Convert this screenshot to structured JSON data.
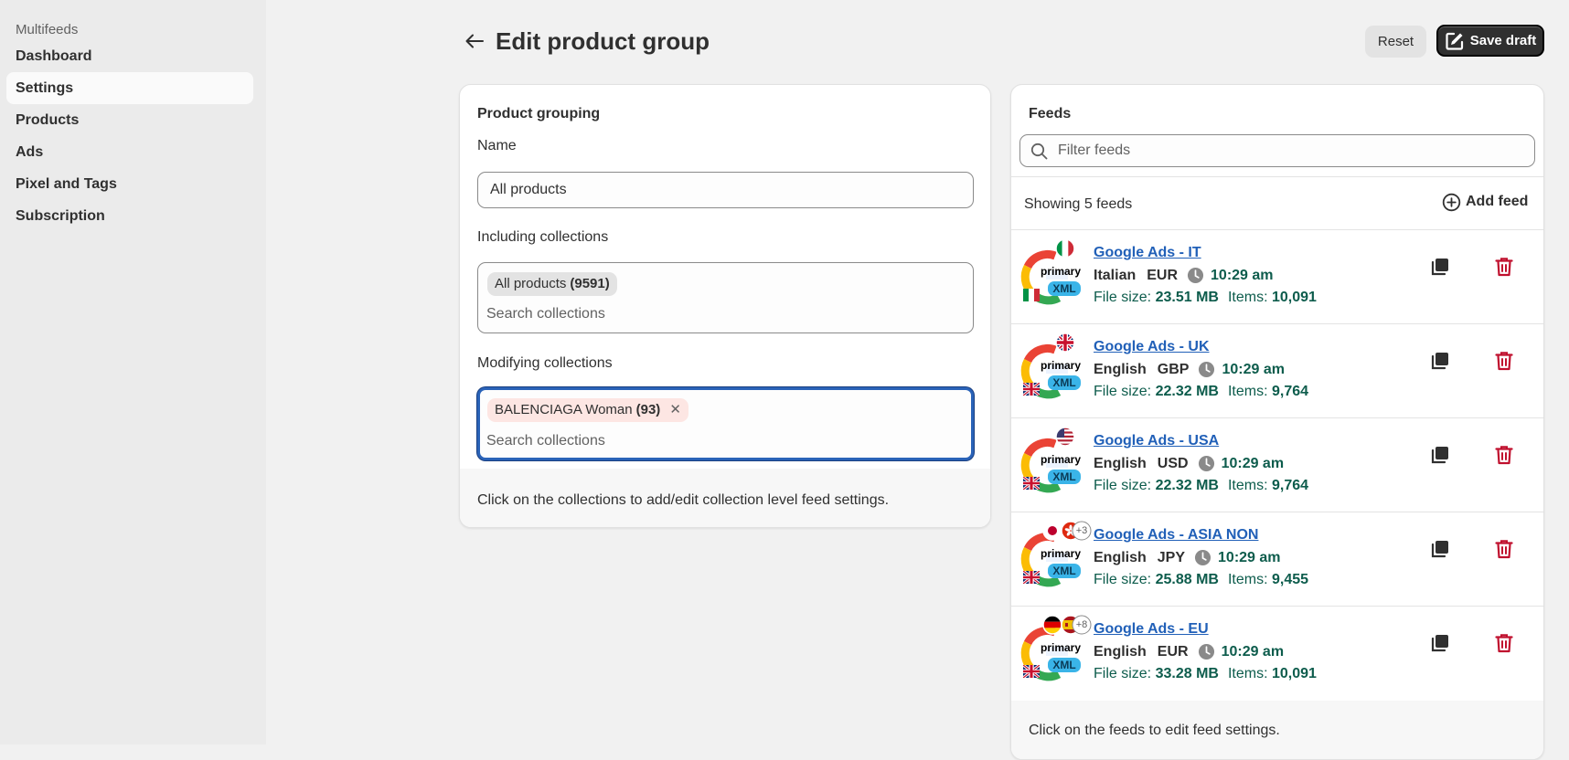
{
  "sidebar": {
    "app_name": "Multifeeds",
    "items": [
      {
        "label": "Dashboard"
      },
      {
        "label": "Settings",
        "active": true
      },
      {
        "label": "Products"
      },
      {
        "label": "Ads"
      },
      {
        "label": "Pixel and Tags"
      },
      {
        "label": "Subscription"
      }
    ]
  },
  "header": {
    "title": "Edit product group",
    "reset_label": "Reset",
    "save_label": "Save draft"
  },
  "grouping": {
    "heading": "Product grouping",
    "name_label": "Name",
    "name_value": "All products",
    "including_label": "Including collections",
    "including_tag_name": "All products",
    "including_tag_count": "(9591)",
    "including_placeholder": "Search collections",
    "modifying_label": "Modifying collections",
    "modifying_tag_name": "BALENCIAGA Woman",
    "modifying_tag_count": "(93)",
    "modifying_placeholder": "Search collections",
    "footer": "Click on the collections to add/edit collection level feed settings."
  },
  "feeds": {
    "heading": "Feeds",
    "filter_placeholder": "Filter feeds",
    "showing": "Showing 5 feeds",
    "add_label": "Add feed",
    "badge_primary": "primary",
    "badge_xml": "XML",
    "size_prefix": "File size:",
    "items_prefix": "Items:",
    "list": [
      {
        "title": "Google Ads - IT",
        "language": "Italian",
        "currency": "EUR",
        "time": "10:29 am",
        "size": "23.51 MB",
        "items": "10,091",
        "flags": [
          "it"
        ],
        "extra": "",
        "small_flag": "it"
      },
      {
        "title": "Google Ads - UK",
        "language": "English",
        "currency": "GBP",
        "time": "10:29 am",
        "size": "22.32 MB",
        "items": "9,764",
        "flags": [
          "uk"
        ],
        "extra": "",
        "small_flag": "uk"
      },
      {
        "title": "Google Ads - USA",
        "language": "English",
        "currency": "USD",
        "time": "10:29 am",
        "size": "22.32 MB",
        "items": "9,764",
        "flags": [
          "us"
        ],
        "extra": "",
        "small_flag": "uk"
      },
      {
        "title": "Google Ads - ASIA NON",
        "language": "English",
        "currency": "JPY",
        "time": "10:29 am",
        "size": "25.88 MB",
        "items": "9,455",
        "flags": [
          "jp",
          "hk"
        ],
        "extra": "+3",
        "small_flag": "uk"
      },
      {
        "title": "Google Ads - EU",
        "language": "English",
        "currency": "EUR",
        "time": "10:29 am",
        "size": "33.28 MB",
        "items": "10,091",
        "flags": [
          "de",
          "es"
        ],
        "extra": "+8",
        "small_flag": "uk"
      }
    ],
    "footer": "Click on the feeds to edit feed settings."
  },
  "colors": {
    "accent_link": "#2160b8",
    "focus_ring": "#2a63b8",
    "delete": "#c0102e",
    "meta_green": "#0d5c4c",
    "primary_button": "#303030"
  },
  "icons": [
    "arrow-left-icon",
    "edit-icon",
    "search-icon",
    "plus-circle-icon",
    "clock-icon",
    "duplicate-icon",
    "trash-icon",
    "google-logo-icon"
  ]
}
